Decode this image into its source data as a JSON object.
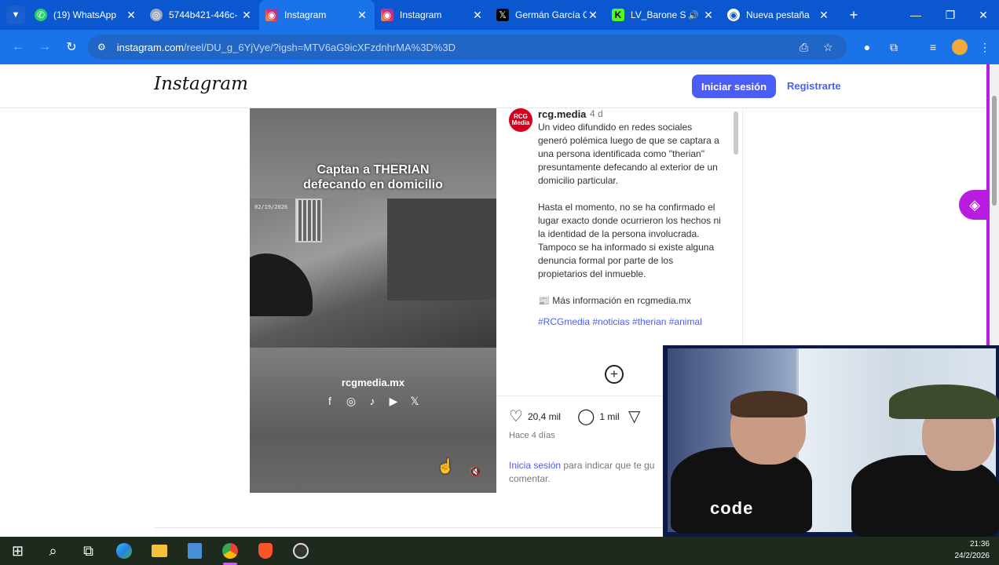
{
  "browser": {
    "tabs": [
      {
        "label": "(19) WhatsApp",
        "icon": "whatsapp-icon",
        "active": false
      },
      {
        "label": "5744b421-446c-",
        "icon": "globe-icon",
        "active": false
      },
      {
        "label": "Instagram",
        "icon": "instagram-icon",
        "active": true
      },
      {
        "label": "Instagram",
        "icon": "instagram-icon",
        "active": false
      },
      {
        "label": "Germán García C",
        "icon": "x-icon",
        "active": false
      },
      {
        "label": "LV_Barone S",
        "icon": "kick-icon",
        "active": false
      },
      {
        "label": "Nueva pestaña",
        "icon": "chrome-icon",
        "active": false
      }
    ],
    "url_host": "instagram.com",
    "url_path": "/reel/DU_g_6YjVye/?igsh=MTV6aG9icXFzdnhrMA%3D%3D"
  },
  "instagram": {
    "logo": "Instagram",
    "login_label": "Iniciar sesión",
    "signup_label": "Registrarte"
  },
  "post": {
    "video_caption_line1": "Captan a THERIAN",
    "video_caption_line2": "defecando en domicilio",
    "video_timestamp": "02/19/2026",
    "video_site": "rcgmedia.mx",
    "avatar_text": "RCG Media",
    "username": "rcg.media",
    "age": "4 d",
    "caption_p1": "Un video difundido en redes sociales generó polémica luego de que se captara a una persona identificada como \"therian\" presuntamente defecando al exterior de un domicilio particular.",
    "caption_p2": "Hasta el momento, no se ha confirmado el lugar exacto donde ocurrieron los hechos ni la identidad de la persona involucrada. Tampoco se ha informado si existe alguna denuncia formal por parte de los propietarios del inmueble.",
    "caption_p3": "📰 Más información en rcgmedia.mx",
    "hashtags": "#RCGmedia #noticias #therian #animal",
    "likes": "20,4 mil",
    "comments": "1 mil",
    "posted": "Hace 4 días",
    "login_link": "Inicia sesión",
    "login_rest": " para indicar que te gu",
    "login_rest2": "comentar."
  },
  "webcam": {
    "shirt_text": "code"
  },
  "taskbar": {
    "time": "21:36",
    "date": "24/2/2026"
  },
  "colors": {
    "chrome_blue": "#0b57d0",
    "instagram_blue": "#4a5df9",
    "accent_purple": "#b71ce0",
    "brand_red": "#d6001c"
  }
}
